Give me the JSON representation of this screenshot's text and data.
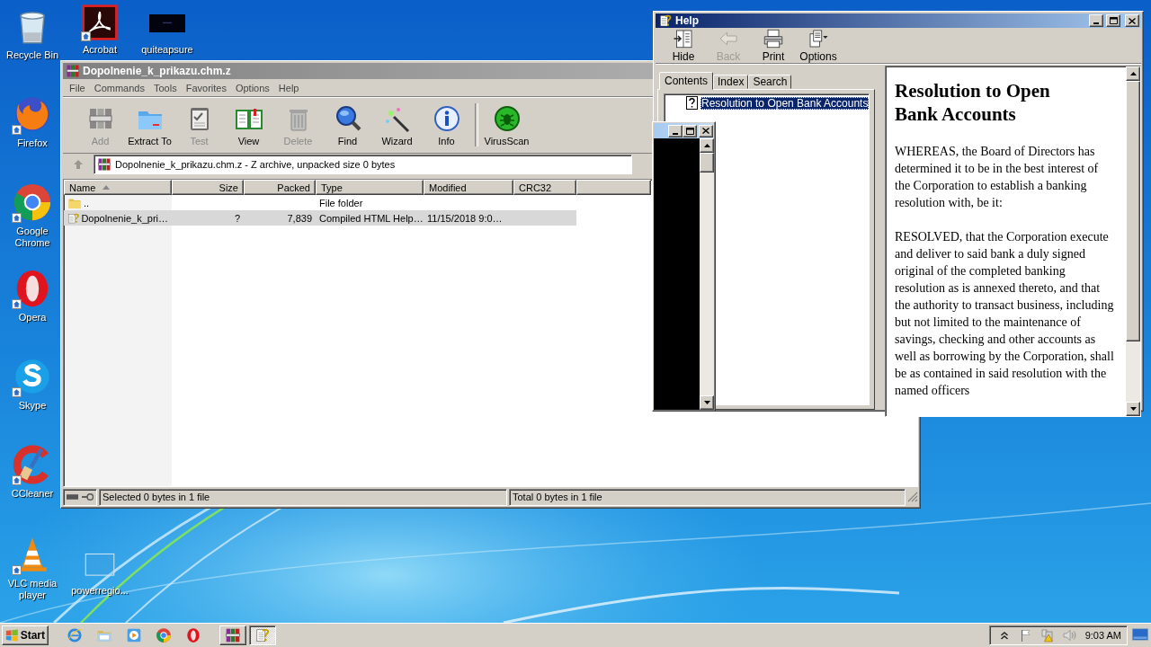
{
  "desktop_icons": [
    {
      "kind": "recycle",
      "label": "Recycle Bin",
      "shortcut": false
    },
    {
      "kind": "acrobat",
      "label": "Acrobat",
      "shortcut": true
    },
    {
      "kind": "dark",
      "label": "quiteapsure",
      "shortcut": false
    },
    {
      "kind": "firefox",
      "label": "Firefox",
      "shortcut": true
    },
    {
      "kind": "chrome",
      "label": "Google Chrome",
      "shortcut": true
    },
    {
      "kind": "opera",
      "label": "Opera",
      "shortcut": true
    },
    {
      "kind": "skype",
      "label": "Skype",
      "shortcut": true
    },
    {
      "kind": "ccleaner",
      "label": "CCleaner",
      "shortcut": true
    },
    {
      "kind": "vlc",
      "label": "VLC media player",
      "shortcut": true
    },
    {
      "kind": "blank",
      "label": "powerregio...",
      "shortcut": false
    }
  ],
  "winrar": {
    "title": "Dopolnenie_k_prikazu.chm.z",
    "active": false,
    "menu": [
      "File",
      "Commands",
      "Tools",
      "Favorites",
      "Options",
      "Help"
    ],
    "toolbar": [
      {
        "kind": "add",
        "label": "Add",
        "disabled": true
      },
      {
        "kind": "extract",
        "label": "Extract To",
        "disabled": false
      },
      {
        "kind": "test",
        "label": "Test",
        "disabled": true
      },
      {
        "kind": "view",
        "label": "View",
        "disabled": false
      },
      {
        "kind": "delete",
        "label": "Delete",
        "disabled": true
      },
      {
        "kind": "find",
        "label": "Find",
        "disabled": false
      },
      {
        "kind": "wizard",
        "label": "Wizard",
        "disabled": false
      },
      {
        "kind": "info",
        "label": "Info",
        "disabled": false
      },
      {
        "kind": "virusscan",
        "label": "VirusScan",
        "disabled": false
      }
    ],
    "path": "Dopolnenie_k_prikazu.chm.z - Z archive, unpacked size 0 bytes",
    "columns": [
      {
        "label": "Name",
        "sorted": true
      },
      {
        "label": "Size",
        "sorted": false
      },
      {
        "label": "Packed",
        "sorted": false
      },
      {
        "label": "Type",
        "sorted": false
      },
      {
        "label": "Modified",
        "sorted": false
      },
      {
        "label": "CRC32",
        "sorted": false
      }
    ],
    "rows": [
      {
        "kind": "folder",
        "name": "..",
        "type": "File folder",
        "selected": false
      },
      {
        "kind": "chm",
        "name": "Dopolnenie_k_pri…",
        "size": "?",
        "packed": "7,839",
        "type": "Compiled HTML Help…",
        "modified": "11/15/2018 9:0…",
        "selected": true
      }
    ],
    "status": [
      "Selected 0 bytes in 1 file",
      "Total 0 bytes in 1 file"
    ]
  },
  "help": {
    "title": "Help",
    "active": true,
    "toolbar": [
      {
        "kind": "hide",
        "label": "Hide",
        "disabled": false
      },
      {
        "kind": "back",
        "label": "Back",
        "disabled": true
      },
      {
        "kind": "print",
        "label": "Print",
        "disabled": false
      },
      {
        "kind": "options",
        "label": "Options",
        "disabled": false
      }
    ],
    "tabs": [
      {
        "label": "Contents",
        "selected": true
      },
      {
        "label": "Index",
        "selected": false
      },
      {
        "label": "Search",
        "selected": false
      }
    ],
    "tree": [
      {
        "label": "Resolution to Open Bank Accounts",
        "selected": true
      }
    ],
    "heading": "Resolution to Open Bank Accounts",
    "paragraphs": [
      "WHEREAS, the Board of Directors has determined it to be in the best interest of the Corporation to establish a banking resolution with, be it:",
      "RESOLVED, that the Corporation execute and deliver to said bank a duly signed original of the completed banking resolution as is annexed thereto, and that the authority to transact business, including but not limited to the maintenance of savings, checking and other accounts as well as borrowing by the Corporation, shall be as contained in said resolution with the named officers"
    ]
  },
  "taskbar": {
    "start": "Start",
    "quick_launch": [
      {
        "kind": "ie"
      },
      {
        "kind": "explorer"
      },
      {
        "kind": "media"
      },
      {
        "kind": "chrome"
      },
      {
        "kind": "opera"
      }
    ],
    "tasks": [
      {
        "kind": "winrar",
        "active": false
      },
      {
        "kind": "help",
        "active": true
      }
    ],
    "tray": [
      {
        "kind": "chevron"
      },
      {
        "kind": "flag"
      },
      {
        "kind": "network"
      },
      {
        "kind": "volume"
      }
    ],
    "clock": "9:03 AM"
  }
}
